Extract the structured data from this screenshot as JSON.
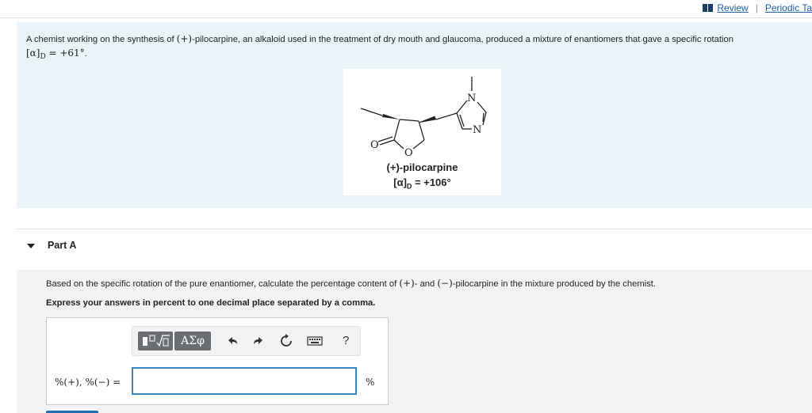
{
  "header": {
    "review_link": "Review",
    "separator": "|",
    "periodic_link": "Periodic Ta"
  },
  "problem": {
    "text_a": "A chemist working on the synthesis of ",
    "sign_plus": "(+)",
    "text_b": "-pilocarpine, an alkaloid used in the treatment of dry mouth and glaucoma, produced a mixture of enantiomers that gave a specific rotation",
    "rotation_symbol": "[α]",
    "rotation_sub": "D",
    "rotation_value": " = +61°",
    "period": "."
  },
  "structure": {
    "atom_n_top": "N",
    "atom_n_bottom": "N",
    "atom_o_carbonyl": "O",
    "atom_o_ring": "O",
    "name": "(+)-pilocarpine",
    "rotation_symbol": "[α]",
    "rotation_sub": "D",
    "rotation_value": " = +106°"
  },
  "part_a": {
    "title": "Part A",
    "instruction_a": "Based on the specific rotation of the pure enantiomer, calculate the percentage content of ",
    "plus": "(+)",
    "instruction_b": "- and ",
    "minus": "(−)",
    "instruction_c": "-pilocarpine in the mixture produced by the chemist.",
    "bold_instruction": "Express your answers in percent to one decimal place separated by a comma.",
    "greek_button": "ΑΣφ",
    "help_button": "?",
    "answer_label": "%(+), %(−) =",
    "answer_value": "",
    "unit": "%"
  }
}
